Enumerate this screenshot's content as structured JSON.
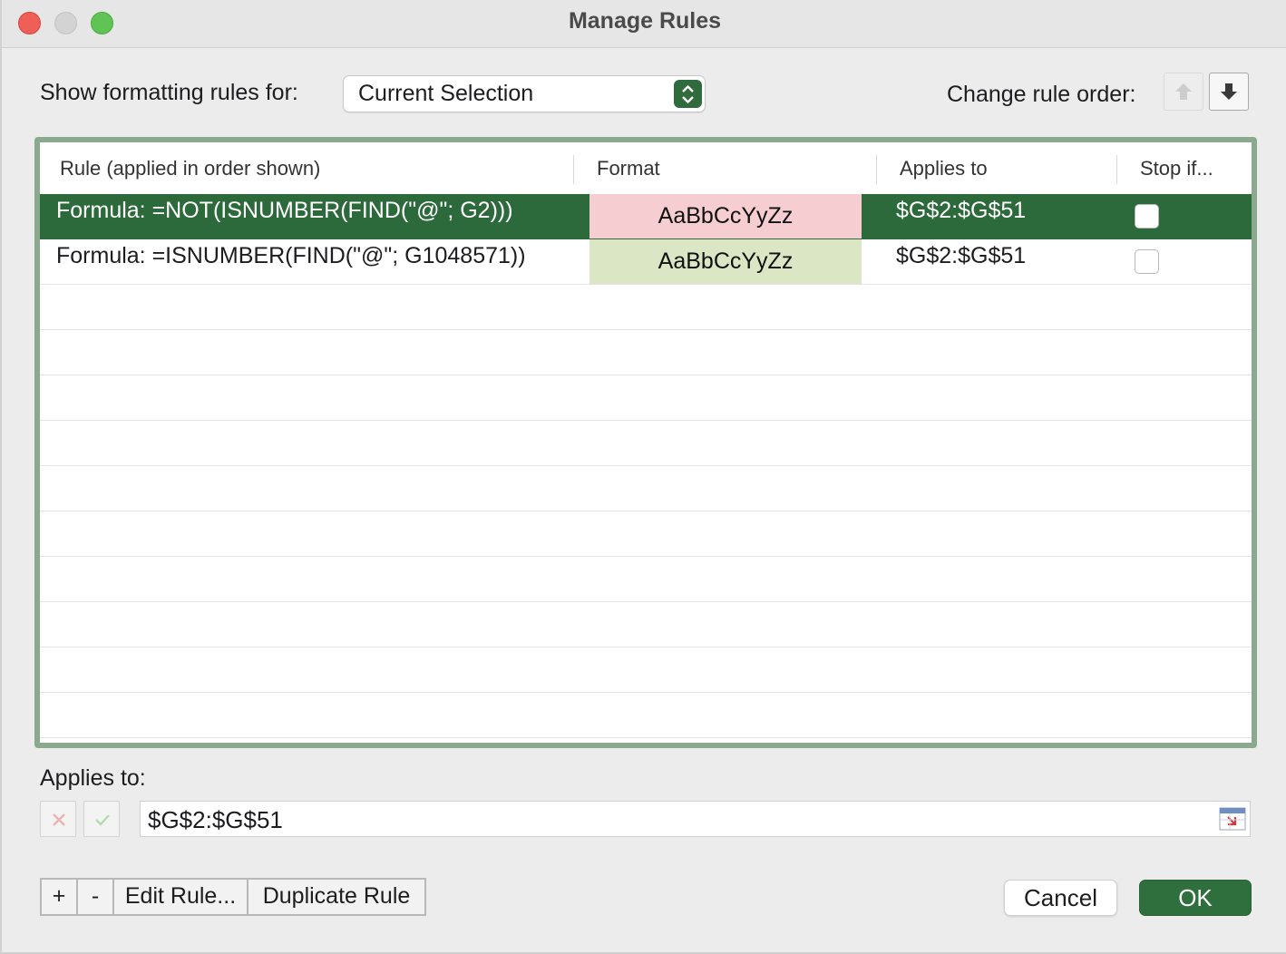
{
  "window": {
    "title": "Manage Rules"
  },
  "header": {
    "show_label": "Show formatting rules for:",
    "scope_value": "Current Selection",
    "order_label": "Change rule order:"
  },
  "table": {
    "columns": [
      "Rule (applied in order shown)",
      "Format",
      "Applies to",
      "Stop if..."
    ],
    "rows": [
      {
        "rule": "Formula: =NOT(ISNUMBER(FIND(\"@\"; G2)))",
        "format_sample": "AaBbCcYyZz",
        "format_color": "#f6cdd0",
        "applies_to": "$G$2:$G$51",
        "stop_if": false,
        "selected": true
      },
      {
        "rule": "Formula: =ISNUMBER(FIND(\"@\"; G1048571))",
        "format_sample": "AaBbCcYyZz",
        "format_color": "#dbe6c4",
        "applies_to": "$G$2:$G$51",
        "stop_if": false,
        "selected": false
      }
    ]
  },
  "applies": {
    "label": "Applies to:",
    "value": "$G$2:$G$51"
  },
  "footer": {
    "add": "+",
    "remove": "-",
    "edit": "Edit Rule...",
    "duplicate": "Duplicate Rule",
    "cancel": "Cancel",
    "ok": "OK"
  },
  "colors": {
    "accent": "#2d6a3b",
    "frame": "#8aa98f"
  }
}
